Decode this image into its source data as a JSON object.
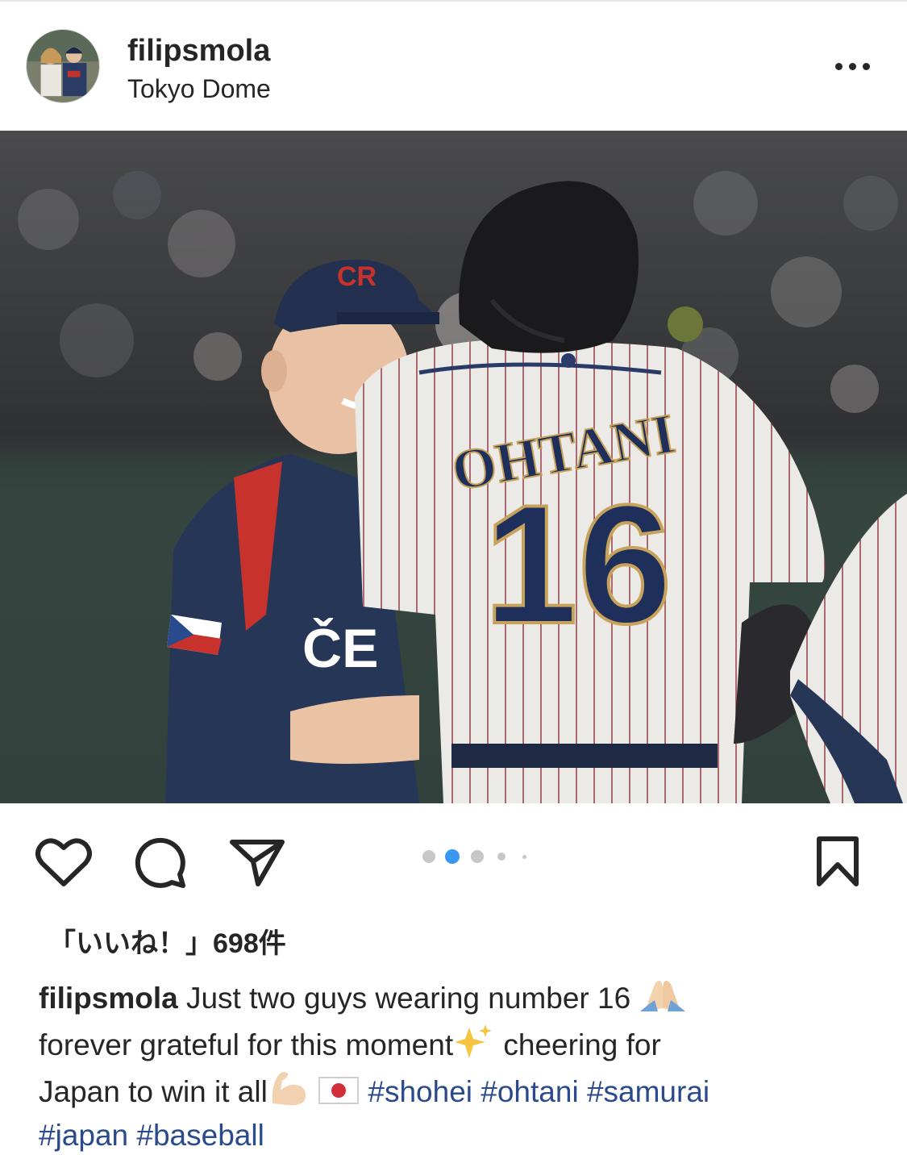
{
  "post": {
    "username": "filipsmola",
    "location": "Tokyo Dome",
    "more_icon": "more-horizontal-icon"
  },
  "photo": {
    "jersey_name": "OHTANI",
    "jersey_number": "16",
    "cap_logo": "CR",
    "shirt_text": "ČE"
  },
  "carousel": {
    "total": 5,
    "active_index": 1,
    "active_color": "#3897f0",
    "inactive_color": "#c7c7c7"
  },
  "actions": {
    "like_icon": "heart-icon",
    "comment_icon": "comment-icon",
    "share_icon": "paper-plane-icon",
    "save_icon": "bookmark-icon"
  },
  "likes": {
    "text": "「いいね！」698件"
  },
  "caption": {
    "username": "filipsmola",
    "line1": "Just two guys wearing number 16",
    "line2a": "forever grateful for this moment",
    "line2b": "cheering for",
    "line3": "Japan to win it all",
    "hashtags": [
      "#shohei",
      "#ohtani",
      "#samurai",
      "#japan",
      "#baseball"
    ],
    "hashtag_color": "#2b4a8b"
  }
}
